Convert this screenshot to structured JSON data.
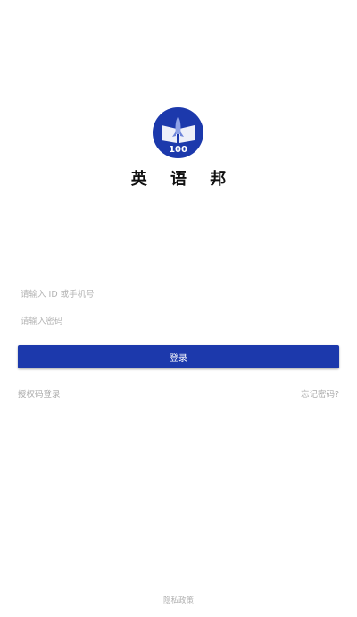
{
  "app": {
    "name": "英 语 邦",
    "logo_text": "100",
    "brand_color": "#1c39ac"
  },
  "form": {
    "id_placeholder": "请输入 ID 或手机号",
    "password_placeholder": "请输入密码",
    "login_label": "登录"
  },
  "links": {
    "auth_code_login": "授权码登录",
    "forgot_password": "忘记密码?"
  },
  "footer": {
    "privacy_policy": "隐私政策"
  }
}
